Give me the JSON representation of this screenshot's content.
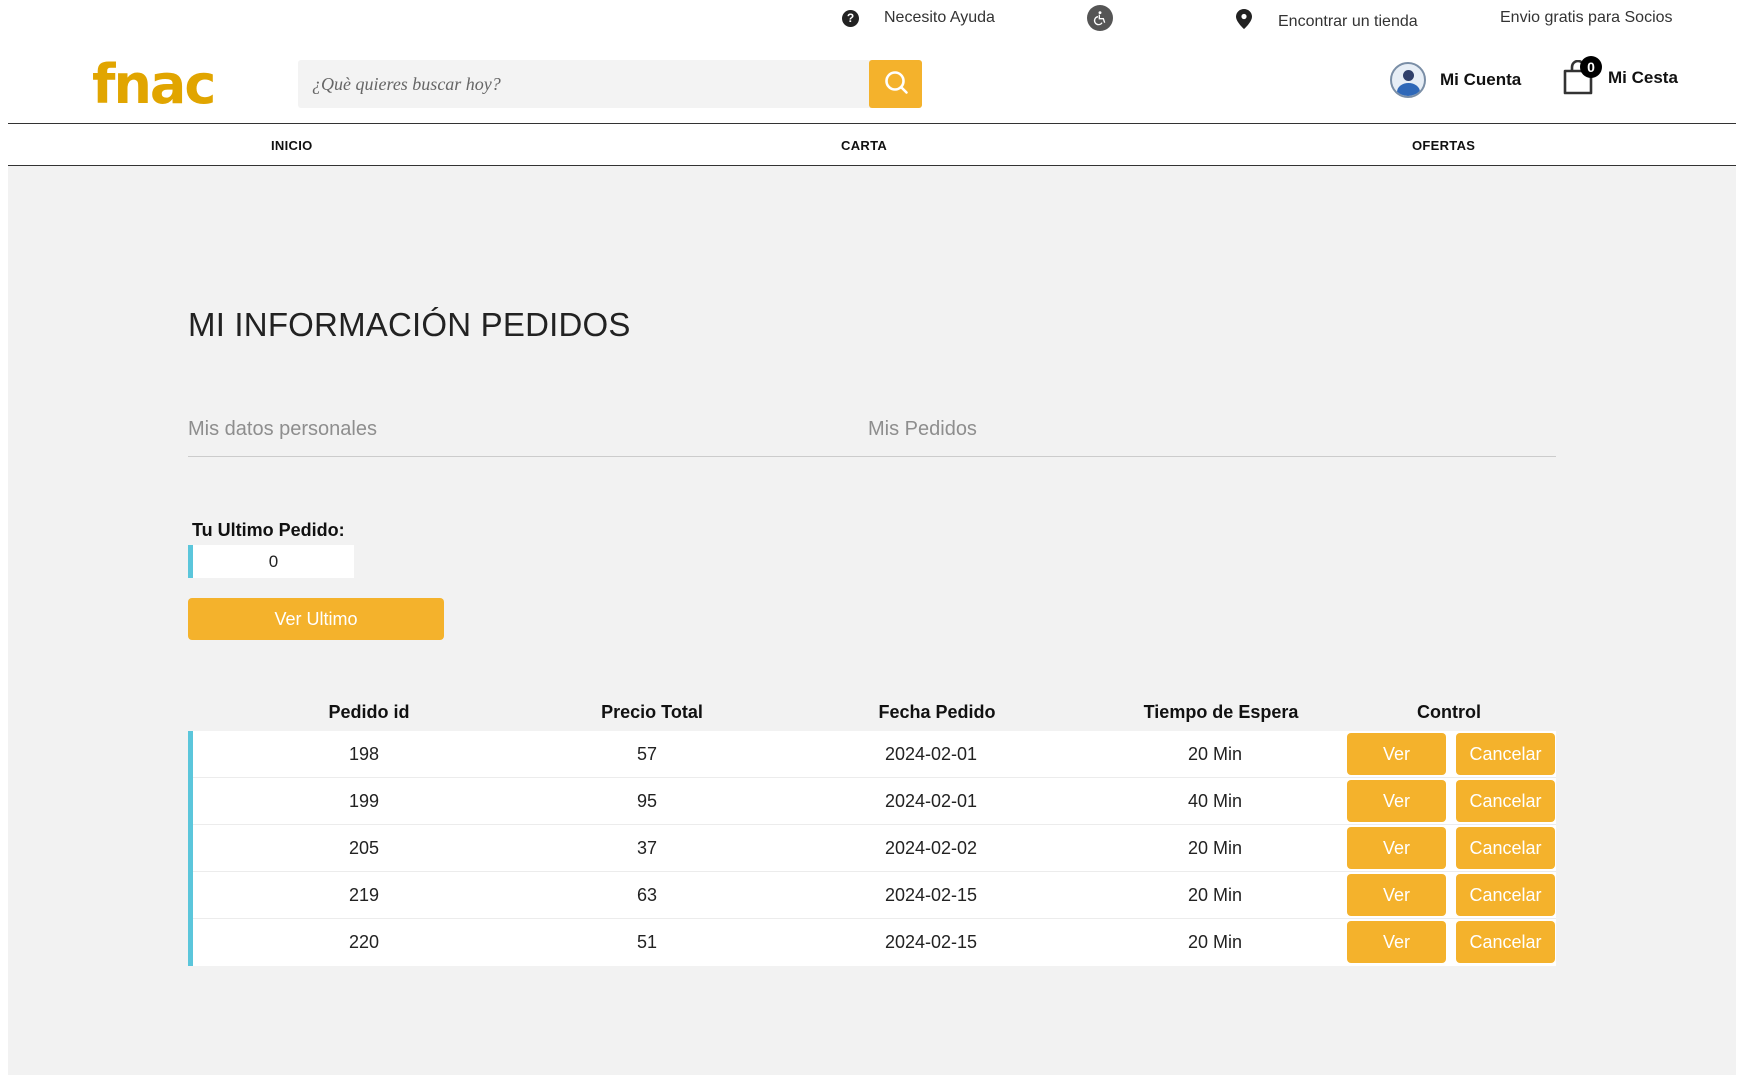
{
  "topbar": {
    "help_label": "Necesito Ayuda",
    "store_label": "Encontrar un tienda",
    "shipping_label": "Envio gratis para Socios"
  },
  "header": {
    "logo_text": "fnac",
    "search_placeholder": "¿Què quieres buscar hoy?",
    "account_label": "Mi Cuenta",
    "cart_label": "Mi Cesta",
    "cart_count": "0"
  },
  "nav": {
    "items": [
      {
        "label": "INICIO"
      },
      {
        "label": "CARTA"
      },
      {
        "label": "OFERTAS"
      }
    ]
  },
  "main": {
    "title": "MI INFORMACIÓN PEDIDOS",
    "tabs": [
      {
        "label": "Mis datos personales"
      },
      {
        "label": "Mis Pedidos"
      }
    ],
    "last_order_label": "Tu Ultimo Pedido:",
    "last_order_value": "0",
    "ver_ultimo_label": "Ver Ultimo"
  },
  "orders": {
    "headers": [
      "Pedido id",
      "Precio Total",
      "Fecha Pedido",
      "Tiempo de Espera",
      "Control"
    ],
    "ver_label": "Ver",
    "cancel_label": "Cancelar",
    "rows": [
      {
        "id": "198",
        "total": "57",
        "date": "2024-02-01",
        "wait": "20 Min"
      },
      {
        "id": "199",
        "total": "95",
        "date": "2024-02-01",
        "wait": "40 Min"
      },
      {
        "id": "205",
        "total": "37",
        "date": "2024-02-02",
        "wait": "20 Min"
      },
      {
        "id": "219",
        "total": "63",
        "date": "2024-02-15",
        "wait": "20 Min"
      },
      {
        "id": "220",
        "total": "51",
        "date": "2024-02-15",
        "wait": "20 Min"
      }
    ]
  },
  "colors": {
    "accent": "#f4b22c",
    "logo": "#e1a500",
    "row_marker": "#5bc6db",
    "main_bg": "#f2f2f2"
  },
  "icons": {
    "help": "question-circle-icon",
    "accessibility": "wheelchair-icon",
    "store": "map-pin-icon",
    "search": "search-icon",
    "account": "user-avatar-icon",
    "cart": "shopping-bag-icon"
  }
}
